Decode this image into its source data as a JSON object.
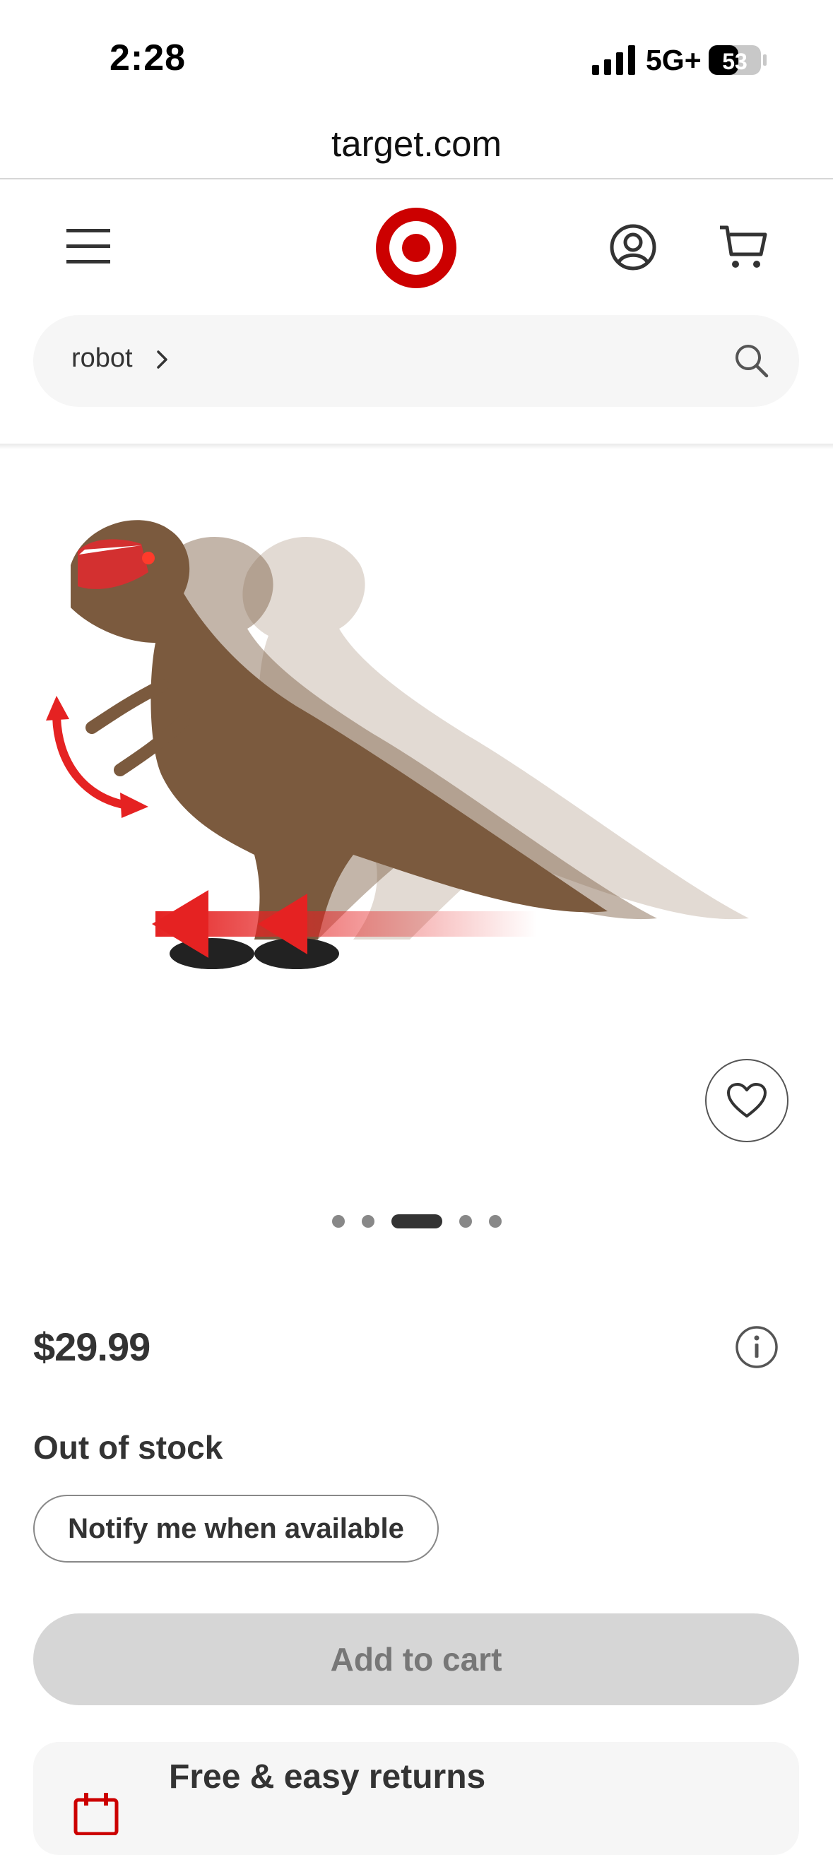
{
  "status_bar": {
    "time": "2:28",
    "network": "5G+",
    "battery": "53"
  },
  "browser": {
    "url": "target.com"
  },
  "header": {
    "menu_icon": "hamburger-menu-icon",
    "logo": "target-bullseye-logo",
    "account_icon": "account-icon",
    "cart_icon": "cart-icon",
    "brand_color": "#cc0000"
  },
  "search": {
    "query": "robot",
    "chevron_icon": "chevron-right-icon",
    "search_icon": "search-icon"
  },
  "product": {
    "image_description_icon": "t-rex-robot-toy-image",
    "favorite_icon": "heart-icon",
    "carousel": {
      "count": 5,
      "active_index": 2
    },
    "price": "$29.99",
    "info_icon": "info-icon",
    "stock_status": "Out of stock",
    "notify_label": "Notify me when available",
    "add_to_cart_label": "Add to cart"
  },
  "returns": {
    "title": "Free & easy returns",
    "icon": "calendar-icon"
  }
}
